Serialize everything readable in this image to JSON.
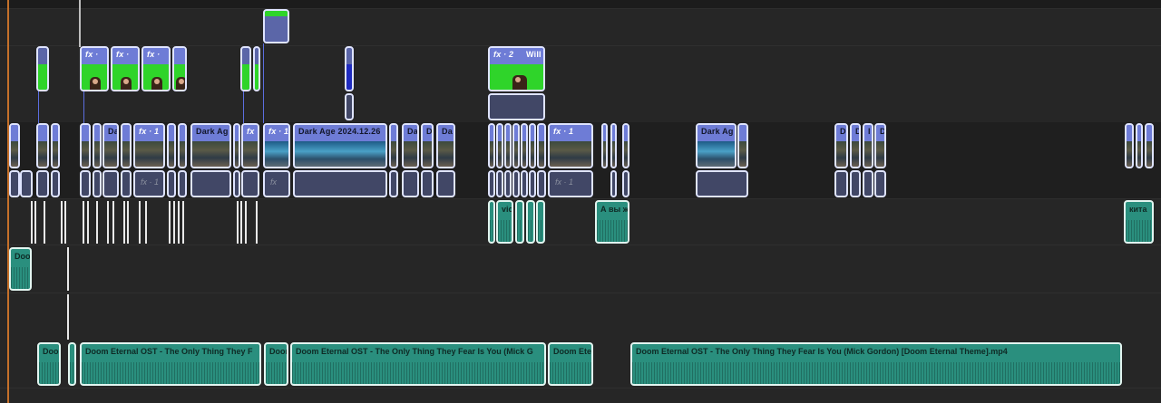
{
  "timeline": {
    "video_clips": {
      "dark_age_1": "Da",
      "dark_age_2": "Dark Ag",
      "dark_age_main": "Dark Age 2024.12.26",
      "dark_age_3": "Da",
      "dark_age_4": "D",
      "dark_age_5": "Da",
      "dark_age_6": "Dark Ag",
      "d1": "D",
      "d2": "D",
      "d3": "I",
      "d4": "D"
    },
    "fx_labels": {
      "fx1": "fx · 1",
      "fx2": "fx · 1",
      "fx3": "fx",
      "fx4": "fx · 2",
      "fx5": "fx · 1",
      "fx_lower_1": "fx · 1",
      "fx_lower_2": "fx",
      "fx_lower_3": "fx · 1",
      "fx_green_a": "fx ·",
      "fx_green_b": "fx ·",
      "fx_green_c": "fx ·"
    },
    "overlay_clip_title": "Will",
    "audio_clips": {
      "doo_top": "Doo",
      "vic": "vic",
      "a_vy": "А вы ж",
      "kita": "кита",
      "doo_bottom": "Doo",
      "ost_1": "Doom Eternal OST - The Only Thing They F",
      "doo_mid": "Doom",
      "ost_2": "Doom Eternal OST - The Only Thing They Fear Is You (Mick G",
      "ost_3": "Doom Ete",
      "ost_4": "Doom Eternal OST - The Only Thing They Fear Is You (Mick Gordon) [Doom Eternal Theme].mp4"
    },
    "colors": {
      "video_clip": "#6e7cd6",
      "audio_clip": "#2a8f7e",
      "green_screen": "#2fd42a",
      "timeline_edge": "#c4702a"
    }
  }
}
